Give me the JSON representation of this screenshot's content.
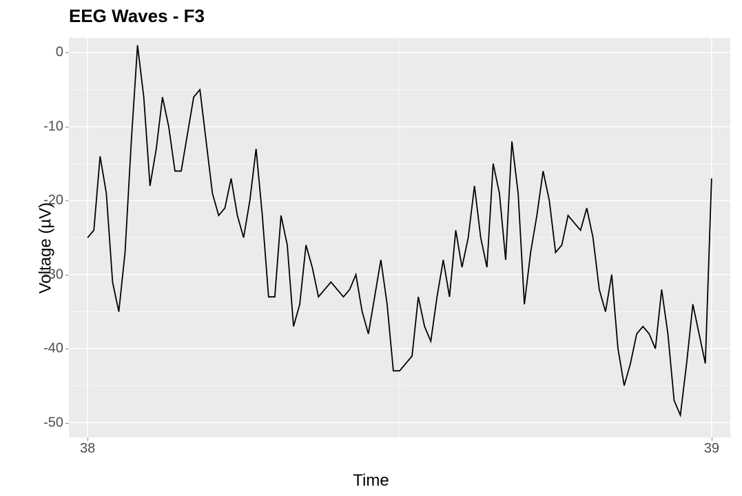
{
  "chart_data": {
    "type": "line",
    "title": "EEG Waves - F3",
    "xlabel": "Time",
    "ylabel": "Voltage (µV)",
    "xlim": [
      37.97,
      39.03
    ],
    "ylim": [
      -52,
      2
    ],
    "y_ticks": [
      0,
      -10,
      -20,
      -30,
      -40,
      -50
    ],
    "x_ticks": [
      38,
      39
    ],
    "series": [
      {
        "name": "F3",
        "x": [
          38.0,
          38.01,
          38.02,
          38.03,
          38.04,
          38.05,
          38.06,
          38.07,
          38.08,
          38.09,
          38.1,
          38.11,
          38.12,
          38.13,
          38.14,
          38.15,
          38.16,
          38.17,
          38.18,
          38.19,
          38.2,
          38.21,
          38.22,
          38.23,
          38.24,
          38.25,
          38.26,
          38.27,
          38.28,
          38.29,
          38.3,
          38.31,
          38.32,
          38.33,
          38.34,
          38.35,
          38.36,
          38.37,
          38.38,
          38.39,
          38.4,
          38.41,
          38.42,
          38.43,
          38.44,
          38.45,
          38.46,
          38.47,
          38.48,
          38.49,
          38.5,
          38.51,
          38.52,
          38.53,
          38.54,
          38.55,
          38.56,
          38.57,
          38.58,
          38.59,
          38.6,
          38.61,
          38.62,
          38.63,
          38.64,
          38.65,
          38.66,
          38.67,
          38.68,
          38.69,
          38.7,
          38.71,
          38.72,
          38.73,
          38.74,
          38.75,
          38.76,
          38.77,
          38.78,
          38.79,
          38.8,
          38.81,
          38.82,
          38.83,
          38.84,
          38.85,
          38.86,
          38.87,
          38.88,
          38.89,
          38.9,
          38.91,
          38.92,
          38.93,
          38.94,
          38.95,
          38.96,
          38.97,
          38.98,
          38.99,
          39.0
        ],
        "values": [
          -25,
          -24,
          -14,
          -19,
          -31,
          -35,
          -27,
          -12,
          1,
          -6,
          -18,
          -13,
          -6,
          -10,
          -16,
          -16,
          -11,
          -6,
          -5,
          -12,
          -19,
          -22,
          -21,
          -17,
          -22,
          -25,
          -20,
          -13,
          -22,
          -33,
          -33,
          -22,
          -26,
          -37,
          -34,
          -26,
          -29,
          -33,
          -32,
          -31,
          -32,
          -33,
          -32,
          -30,
          -35,
          -38,
          -33,
          -28,
          -34,
          -43,
          -43,
          -42,
          -41,
          -33,
          -37,
          -39,
          -33,
          -28,
          -33,
          -24,
          -29,
          -25,
          -18,
          -25,
          -29,
          -15,
          -19,
          -28,
          -12,
          -19,
          -34,
          -27,
          -22,
          -16,
          -20,
          -27,
          -26,
          -22,
          -23,
          -24,
          -21,
          -25,
          -32,
          -35,
          -30,
          -40,
          -45,
          -42,
          -38,
          -37,
          -38,
          -40,
          -32,
          -38,
          -47,
          -49,
          -42,
          -34,
          -38,
          -42,
          -17
        ]
      }
    ]
  }
}
